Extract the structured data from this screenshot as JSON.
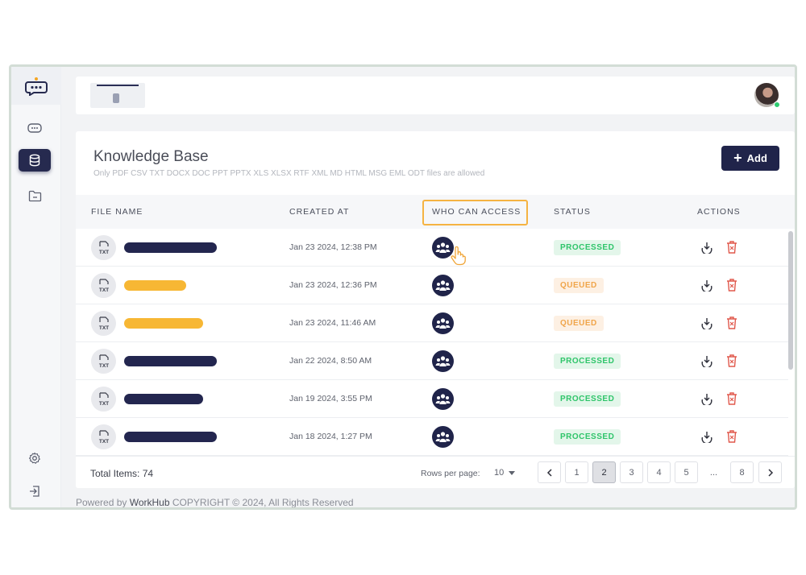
{
  "sidebar": {
    "items": [
      {
        "icon": "chatbot-icon",
        "active": false
      },
      {
        "icon": "database-icon",
        "active": true
      },
      {
        "icon": "folder-icon",
        "active": false
      }
    ],
    "bottom": [
      {
        "icon": "settings-gear-icon"
      },
      {
        "icon": "logout-icon"
      }
    ]
  },
  "page": {
    "title": "Knowledge Base",
    "subtitle": "Only PDF CSV TXT DOCX DOC PPT PPTX XLS XLSX RTF XML MD HTML MSG EML ODT files are allowed",
    "add_label": "Add"
  },
  "table": {
    "columns": [
      "FILE NAME",
      "CREATED AT",
      "WHO CAN ACCESS",
      "STATUS",
      "ACTIONS"
    ],
    "highlighted_column": "WHO CAN ACCESS",
    "rows": [
      {
        "file_type": "TXT",
        "name_color": "#23264f",
        "created": "Jan 23 2024, 12:38 PM",
        "status": "PROCESSED"
      },
      {
        "file_type": "TXT",
        "name_color": "#f7b734",
        "created": "Jan 23 2024, 12:36 PM",
        "status": "QUEUED"
      },
      {
        "file_type": "TXT",
        "name_color": "#f7b734",
        "created": "Jan 23 2024, 11:46 AM",
        "status": "QUEUED"
      },
      {
        "file_type": "TXT",
        "name_color": "#23264f",
        "created": "Jan 22 2024, 8:50 AM",
        "status": "PROCESSED"
      },
      {
        "file_type": "TXT",
        "name_color": "#23264f",
        "created": "Jan 19 2024, 3:55 PM",
        "status": "PROCESSED"
      },
      {
        "file_type": "TXT",
        "name_color": "#23264f",
        "created": "Jan 18 2024, 1:27 PM",
        "status": "PROCESSED"
      }
    ]
  },
  "footer": {
    "total": "Total Items: 74",
    "rows_per_page_label": "Rows per page:",
    "rows_per_page_value": "10",
    "pages": [
      "1",
      "2",
      "3",
      "4",
      "5",
      "...",
      "8"
    ],
    "current_page": "2"
  },
  "powered": {
    "prefix": "Powered by ",
    "brand": "WorkHub",
    "suffix": " COPYRIGHT © 2024, All Rights Reserved"
  },
  "colors": {
    "primary": "#20244a",
    "highlight": "#f5b342",
    "processed": "#2fc56a",
    "queued": "#f0a54a",
    "delete": "#e0584c"
  }
}
